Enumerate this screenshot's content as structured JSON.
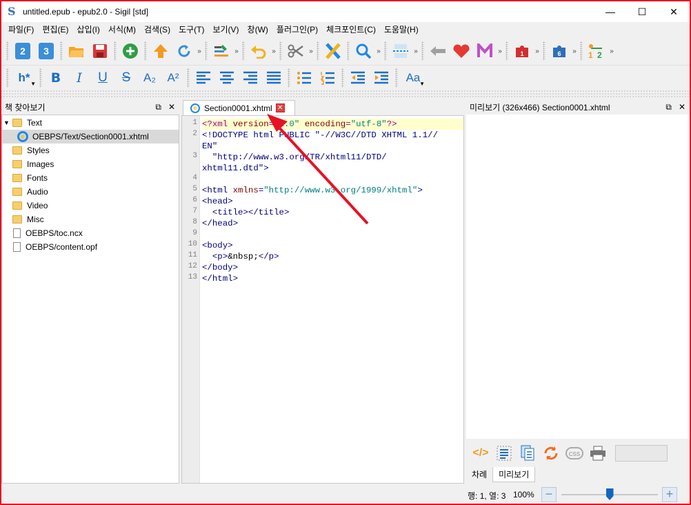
{
  "window": {
    "title": "untitled.epub - epub2.0 - Sigil [std]",
    "app_glyph": "S",
    "min": "—",
    "max": "☐",
    "close": "✕"
  },
  "menu": [
    "파일(F)",
    "편집(E)",
    "삽입(I)",
    "서식(M)",
    "검색(S)",
    "도구(T)",
    "보기(V)",
    "창(W)",
    "플러그인(P)",
    "체크포인트(C)",
    "도움말(H)"
  ],
  "toolbar2": {
    "heading": "h*",
    "bold": "B",
    "italic": "I",
    "underline": "U",
    "strike": "S",
    "sub": "A₂",
    "sup": "A²",
    "case": "Aa"
  },
  "book_browser": {
    "title": "책 찾아보기",
    "items": [
      {
        "label": "Text",
        "kind": "folder",
        "expanded": true
      },
      {
        "label": "OEBPS/Text/Section0001.xhtml",
        "kind": "xhtml",
        "selected": true
      },
      {
        "label": "Styles",
        "kind": "folder"
      },
      {
        "label": "Images",
        "kind": "folder"
      },
      {
        "label": "Fonts",
        "kind": "folder"
      },
      {
        "label": "Audio",
        "kind": "folder"
      },
      {
        "label": "Video",
        "kind": "folder"
      },
      {
        "label": "Misc",
        "kind": "folder"
      },
      {
        "label": "OEBPS/toc.ncx",
        "kind": "file"
      },
      {
        "label": "OEBPS/content.opf",
        "kind": "file"
      }
    ]
  },
  "editor": {
    "tab_label": "Section0001.xhtml",
    "line_numbers": [
      "1",
      "2",
      "",
      "3",
      "",
      "4",
      "5",
      "6",
      "7",
      "8",
      "9",
      "10",
      "11",
      "12",
      "13"
    ]
  },
  "preview": {
    "title": "미리보기 (326x466) Section0001.xhtml",
    "tabs": [
      "차례",
      "미리보기"
    ],
    "active_tab": "미리보기"
  },
  "status": {
    "position": "행: 1, 열: 3",
    "zoom": "100%",
    "zoom_level": 0.5
  },
  "colors": {
    "frame_border": "#e81123",
    "annotation_arrow": "#e81123",
    "current_line": "#ffffcc"
  }
}
